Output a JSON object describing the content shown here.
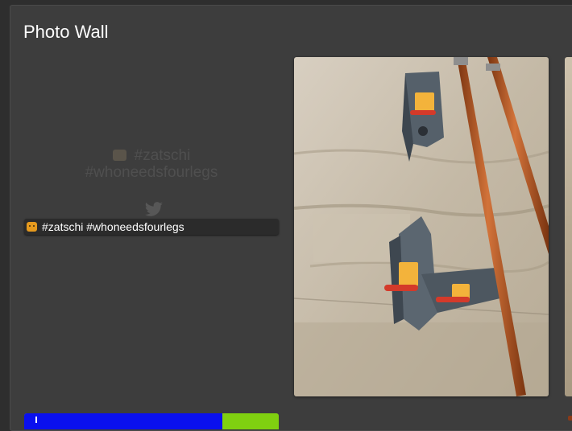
{
  "page": {
    "title": "Photo Wall"
  },
  "tweet": {
    "ghost_text_line1": "#zatschi",
    "ghost_text_line2": "#whoneedsfourlegs",
    "caption": "#zatschi #whoneedsfourlegs",
    "emoji_icon": "cat-face-icon",
    "source_icon": "twitter-bird-icon"
  },
  "photo": {
    "description_icon": "wall-photo"
  },
  "progress": {
    "fraction": 0.78,
    "fill_color": "#0a10ee",
    "track_color": "#80d010"
  },
  "colors": {
    "background": "#2e2e2e",
    "panel": "#3d3d3d",
    "text": "#ffffff",
    "ghost_text": "#4f4f4f"
  }
}
